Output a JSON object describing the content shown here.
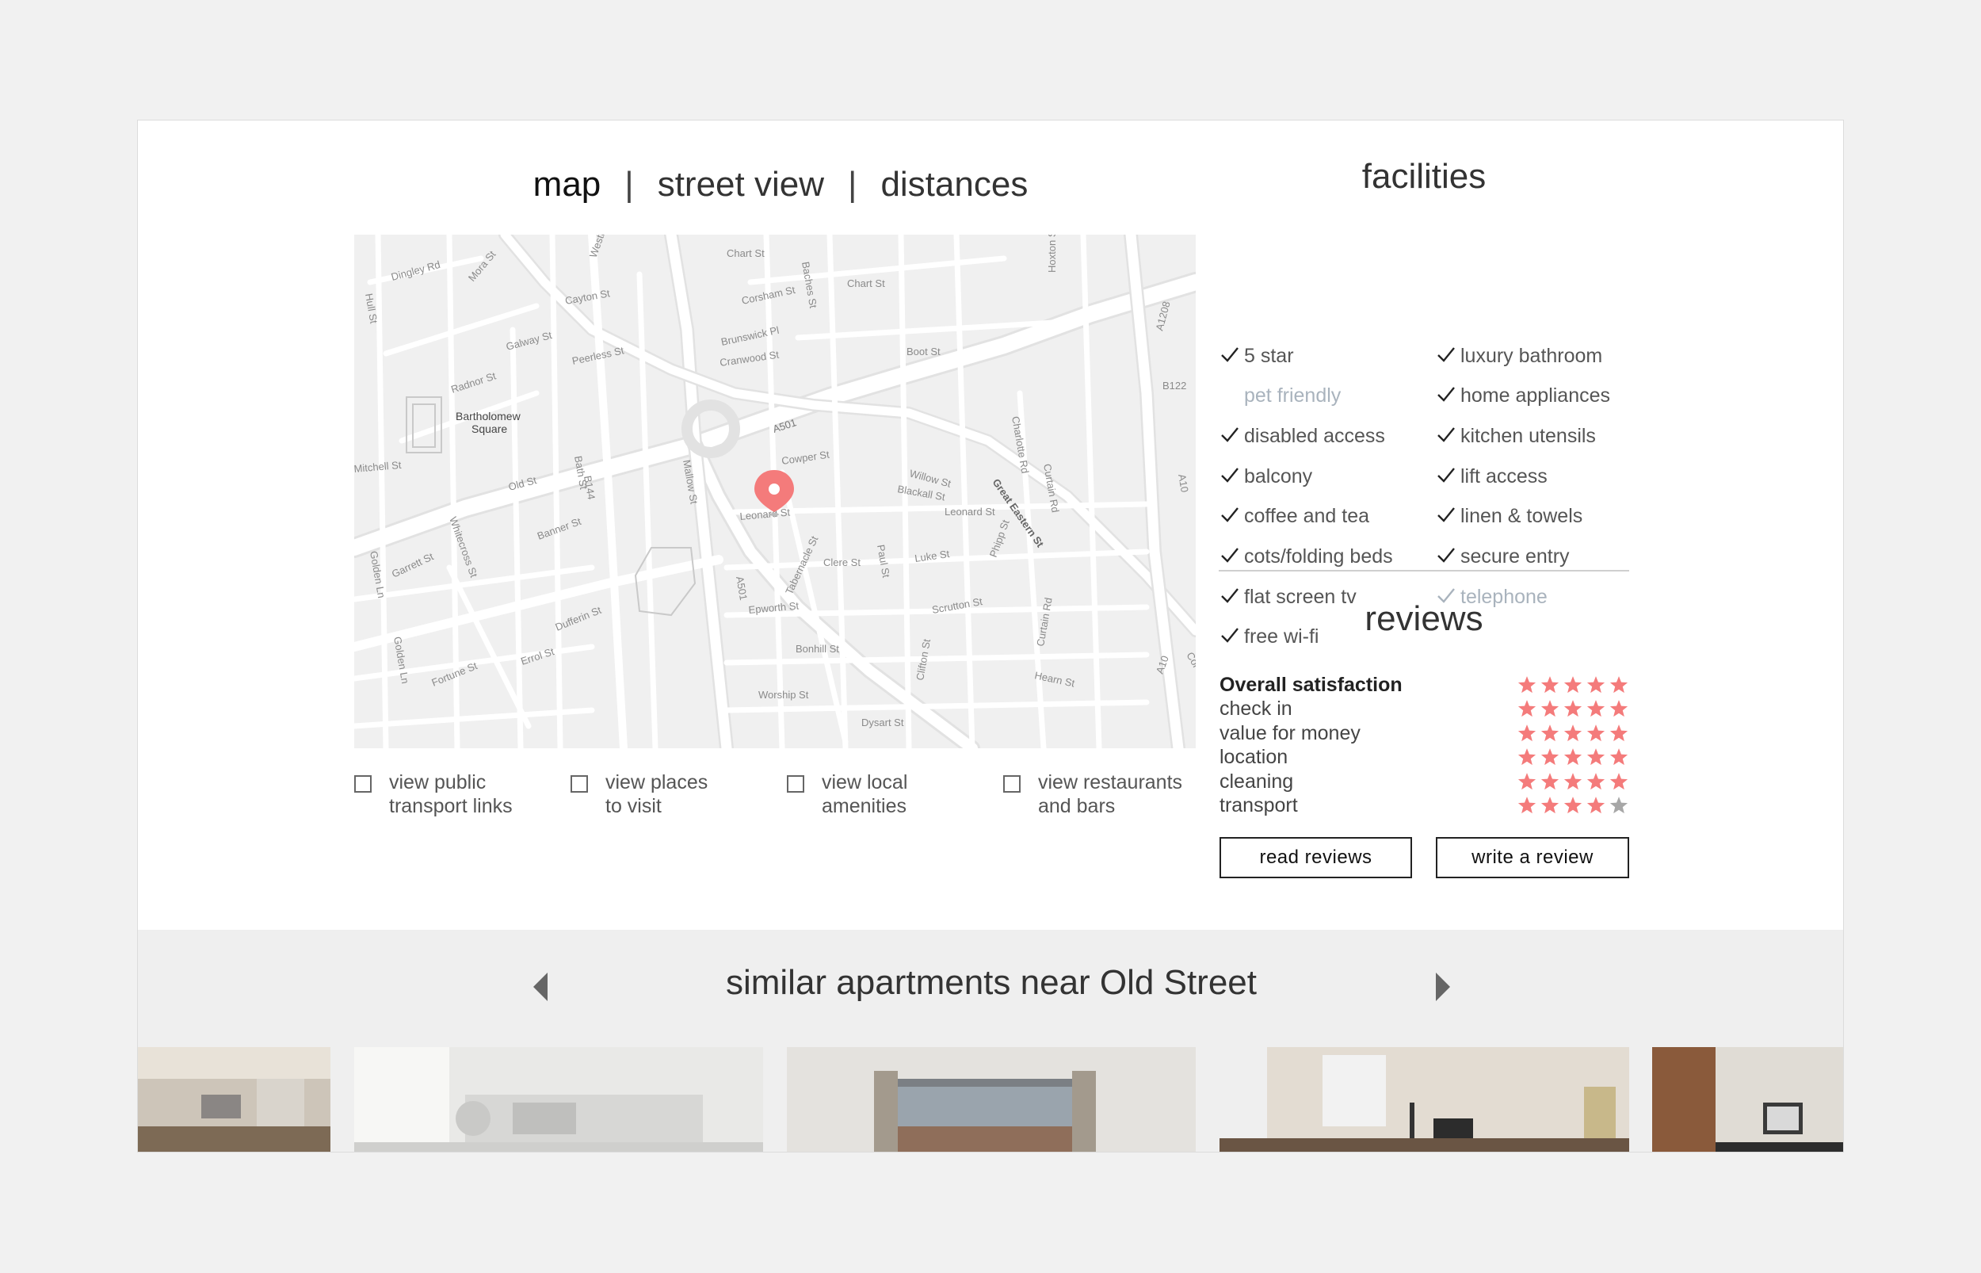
{
  "tabs": {
    "map": "map",
    "street_view": "street view",
    "distances": "distances",
    "separator": "|"
  },
  "map": {
    "streets": [
      "Chart St",
      "Chart St",
      "Westla",
      "Dingley Rd",
      "Mora St",
      "Cayton St",
      "Hull St",
      "Corsham St",
      "Baches St",
      "Hoxton St",
      "Brunswick Pl",
      "Galway St",
      "Peerless St",
      "Cranwood St",
      "Boot St",
      "A1208",
      "Radnor St",
      "Bartholomew",
      "Square",
      "A501",
      "Bath St",
      "B122",
      "Charlotte Rd",
      "Mitchell St",
      "Old St",
      "Cowper St",
      "Mallow St",
      "B144",
      "Willow St",
      "Blackall St",
      "Leonard St",
      "Leonard St",
      "Great Eastern St",
      "Curtain Rd",
      "A10",
      "Whitecross St",
      "Banner St",
      "Tabernacle St",
      "Clere St",
      "Paul St",
      "Luke St",
      "Phipp St",
      "Garrett St",
      "Golden Ln",
      "Dufferin St",
      "Epworth St",
      "Scrutton St",
      "Bonhill St",
      "Errol St",
      "Fortune St",
      "Golden Ln",
      "A501",
      "Clifton St",
      "Curtain Rd",
      "Hearn St",
      "Worship St",
      "Dysart St",
      "A10",
      "Cor"
    ],
    "pin_color": "#f47b7b"
  },
  "map_options": [
    {
      "line1": "view public",
      "line2": "transport links"
    },
    {
      "line1": "view places",
      "line2": "to visit"
    },
    {
      "line1": "view local",
      "line2": "amenities"
    },
    {
      "line1": "view restaurants",
      "line2": "and bars"
    }
  ],
  "facilities": {
    "title": "facilities",
    "left": [
      {
        "label": "5 star",
        "available": true
      },
      {
        "label": "pet friendly",
        "available": false
      },
      {
        "label": "disabled access",
        "available": true
      },
      {
        "label": "balcony",
        "available": true
      },
      {
        "label": "coffee and tea",
        "available": true
      },
      {
        "label": "cots/folding beds",
        "available": true
      },
      {
        "label": "flat screen tv",
        "available": true
      },
      {
        "label": "free wi-fi",
        "available": true
      }
    ],
    "right": [
      {
        "label": "luxury bathroom",
        "available": true
      },
      {
        "label": "home appliances",
        "available": true
      },
      {
        "label": "kitchen utensils",
        "available": true
      },
      {
        "label": "lift access",
        "available": true
      },
      {
        "label": "linen & towels",
        "available": true
      },
      {
        "label": "secure entry",
        "available": true
      },
      {
        "label": "telephone",
        "available": true,
        "muted": true
      }
    ]
  },
  "reviews": {
    "title": "reviews",
    "rows": [
      {
        "label": "Overall satisfaction",
        "stars": 5,
        "bold": true
      },
      {
        "label": "check in",
        "stars": 5
      },
      {
        "label": "value for money",
        "stars": 5
      },
      {
        "label": "location",
        "stars": 5
      },
      {
        "label": "cleaning",
        "stars": 5
      },
      {
        "label": "transport",
        "stars": 4
      }
    ],
    "max_stars": 5,
    "read_label": "read reviews",
    "write_label": "write a review"
  },
  "similar": {
    "title": "similar apartments near Old Street"
  },
  "colors": {
    "star_on": "#f47b7b",
    "star_off": "#a7a7a7",
    "tick": "#222",
    "muted": "#a9b3bd"
  }
}
